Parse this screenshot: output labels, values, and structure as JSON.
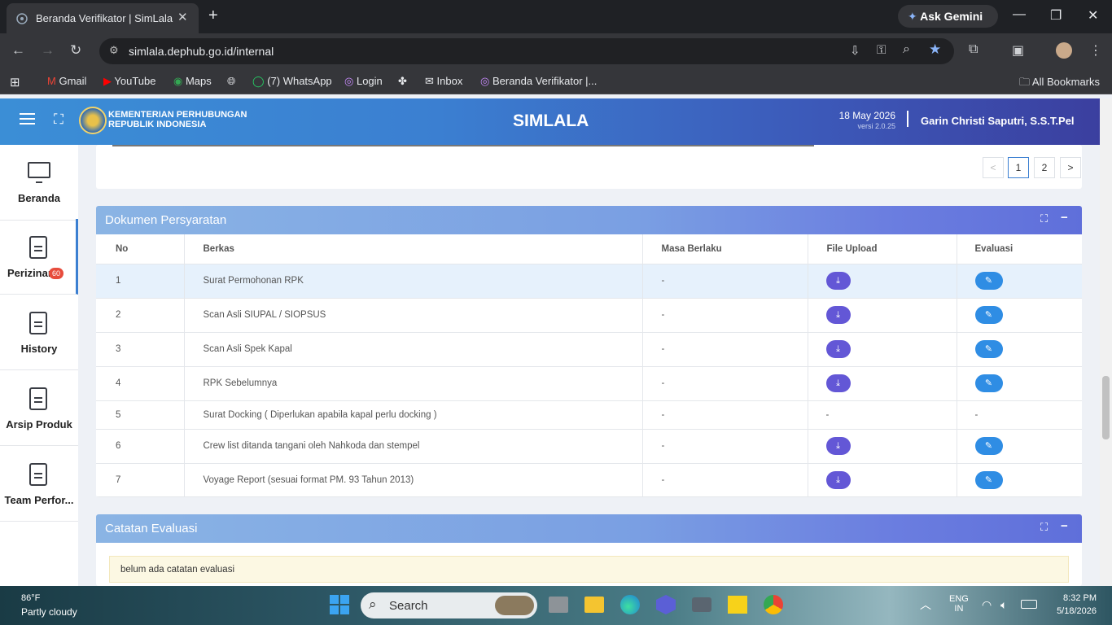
{
  "browser": {
    "tab_title": "Beranda Verifikator | SimLala",
    "ask_gemini": "Ask Gemini",
    "url": "simlala.dephub.go.id/internal",
    "bookmarks": [
      "Gmail",
      "YouTube",
      "Maps",
      "(7) WhatsApp",
      "Login",
      "Inbox",
      "Beranda Verifikator |..."
    ],
    "all_bookmarks": "All Bookmarks"
  },
  "header": {
    "ministry_line1": "KEMENTERIAN PERHUBUNGAN",
    "ministry_line2": "REPUBLIK INDONESIA",
    "app_name": "SIMLALA",
    "date": "18 May 2026",
    "version": "versi 2.0.25",
    "user": "Garin Christi Saputri, S.S.T.Pel"
  },
  "sidebar": {
    "items": [
      {
        "label": "Beranda",
        "icon": "monitor-icon"
      },
      {
        "label": "Perizinan",
        "badge": "60",
        "icon": "document-icon"
      },
      {
        "label": "History",
        "icon": "document-icon"
      },
      {
        "label": "Arsip Produk",
        "icon": "document-icon"
      },
      {
        "label": "Team Perfor...",
        "icon": "document-icon"
      }
    ]
  },
  "pagination": {
    "prev": "<",
    "pages": [
      "1",
      "2"
    ],
    "next": ">",
    "active": "1"
  },
  "dokumen": {
    "title": "Dokumen Persyaratan",
    "columns": [
      "No",
      "Berkas",
      "Masa Berlaku",
      "File Upload",
      "Evaluasi"
    ],
    "rows": [
      {
        "no": "1",
        "berkas": "Surat Permohonan RPK",
        "masa": "-",
        "file": "download",
        "eval": "edit"
      },
      {
        "no": "2",
        "berkas": "Scan Asli SIUPAL / SIOPSUS",
        "masa": "-",
        "file": "download",
        "eval": "edit"
      },
      {
        "no": "3",
        "berkas": "Scan Asli Spek Kapal",
        "masa": "-",
        "file": "download",
        "eval": "edit"
      },
      {
        "no": "4",
        "berkas": "RPK Sebelumnya",
        "masa": "-",
        "file": "download",
        "eval": "edit"
      },
      {
        "no": "5",
        "berkas": "Surat Docking ( Diperlukan apabila kapal perlu docking )",
        "masa": "-",
        "file": "-",
        "eval": "-"
      },
      {
        "no": "6",
        "berkas": "Crew list ditanda tangani oleh Nahkoda dan stempel",
        "masa": "-",
        "file": "download",
        "eval": "edit"
      },
      {
        "no": "7",
        "berkas": "Voyage Report (sesuai format PM. 93 Tahun 2013)",
        "masa": "-",
        "file": "download",
        "eval": "edit"
      }
    ]
  },
  "catatan": {
    "title": "Catatan Evaluasi",
    "text": "belum ada catatan evaluasi"
  },
  "taskbar": {
    "temp": "86°F",
    "weather": "Partly cloudy",
    "search": "Search",
    "lang1": "ENG",
    "lang2": "IN",
    "time": "8:32 PM",
    "date": "5/18/2026"
  }
}
